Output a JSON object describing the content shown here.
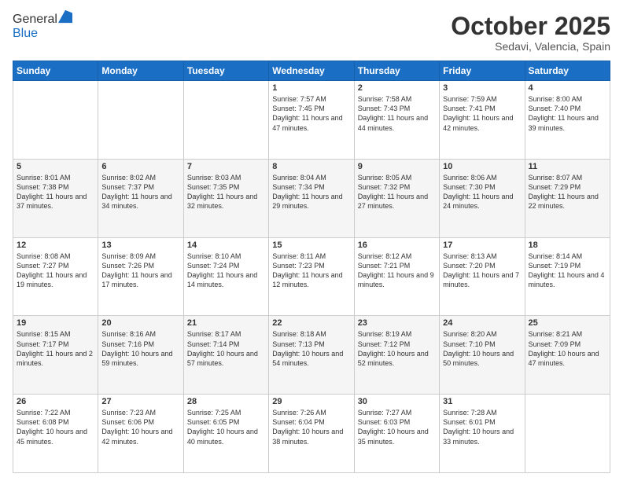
{
  "header": {
    "logo_line1": "General",
    "logo_line2": "Blue",
    "month": "October 2025",
    "location": "Sedavi, Valencia, Spain"
  },
  "weekdays": [
    "Sunday",
    "Monday",
    "Tuesday",
    "Wednesday",
    "Thursday",
    "Friday",
    "Saturday"
  ],
  "weeks": [
    [
      {
        "day": "",
        "info": ""
      },
      {
        "day": "",
        "info": ""
      },
      {
        "day": "",
        "info": ""
      },
      {
        "day": "1",
        "info": "Sunrise: 7:57 AM\nSunset: 7:45 PM\nDaylight: 11 hours and 47 minutes."
      },
      {
        "day": "2",
        "info": "Sunrise: 7:58 AM\nSunset: 7:43 PM\nDaylight: 11 hours and 44 minutes."
      },
      {
        "day": "3",
        "info": "Sunrise: 7:59 AM\nSunset: 7:41 PM\nDaylight: 11 hours and 42 minutes."
      },
      {
        "day": "4",
        "info": "Sunrise: 8:00 AM\nSunset: 7:40 PM\nDaylight: 11 hours and 39 minutes."
      }
    ],
    [
      {
        "day": "5",
        "info": "Sunrise: 8:01 AM\nSunset: 7:38 PM\nDaylight: 11 hours and 37 minutes."
      },
      {
        "day": "6",
        "info": "Sunrise: 8:02 AM\nSunset: 7:37 PM\nDaylight: 11 hours and 34 minutes."
      },
      {
        "day": "7",
        "info": "Sunrise: 8:03 AM\nSunset: 7:35 PM\nDaylight: 11 hours and 32 minutes."
      },
      {
        "day": "8",
        "info": "Sunrise: 8:04 AM\nSunset: 7:34 PM\nDaylight: 11 hours and 29 minutes."
      },
      {
        "day": "9",
        "info": "Sunrise: 8:05 AM\nSunset: 7:32 PM\nDaylight: 11 hours and 27 minutes."
      },
      {
        "day": "10",
        "info": "Sunrise: 8:06 AM\nSunset: 7:30 PM\nDaylight: 11 hours and 24 minutes."
      },
      {
        "day": "11",
        "info": "Sunrise: 8:07 AM\nSunset: 7:29 PM\nDaylight: 11 hours and 22 minutes."
      }
    ],
    [
      {
        "day": "12",
        "info": "Sunrise: 8:08 AM\nSunset: 7:27 PM\nDaylight: 11 hours and 19 minutes."
      },
      {
        "day": "13",
        "info": "Sunrise: 8:09 AM\nSunset: 7:26 PM\nDaylight: 11 hours and 17 minutes."
      },
      {
        "day": "14",
        "info": "Sunrise: 8:10 AM\nSunset: 7:24 PM\nDaylight: 11 hours and 14 minutes."
      },
      {
        "day": "15",
        "info": "Sunrise: 8:11 AM\nSunset: 7:23 PM\nDaylight: 11 hours and 12 minutes."
      },
      {
        "day": "16",
        "info": "Sunrise: 8:12 AM\nSunset: 7:21 PM\nDaylight: 11 hours and 9 minutes."
      },
      {
        "day": "17",
        "info": "Sunrise: 8:13 AM\nSunset: 7:20 PM\nDaylight: 11 hours and 7 minutes."
      },
      {
        "day": "18",
        "info": "Sunrise: 8:14 AM\nSunset: 7:19 PM\nDaylight: 11 hours and 4 minutes."
      }
    ],
    [
      {
        "day": "19",
        "info": "Sunrise: 8:15 AM\nSunset: 7:17 PM\nDaylight: 11 hours and 2 minutes."
      },
      {
        "day": "20",
        "info": "Sunrise: 8:16 AM\nSunset: 7:16 PM\nDaylight: 10 hours and 59 minutes."
      },
      {
        "day": "21",
        "info": "Sunrise: 8:17 AM\nSunset: 7:14 PM\nDaylight: 10 hours and 57 minutes."
      },
      {
        "day": "22",
        "info": "Sunrise: 8:18 AM\nSunset: 7:13 PM\nDaylight: 10 hours and 54 minutes."
      },
      {
        "day": "23",
        "info": "Sunrise: 8:19 AM\nSunset: 7:12 PM\nDaylight: 10 hours and 52 minutes."
      },
      {
        "day": "24",
        "info": "Sunrise: 8:20 AM\nSunset: 7:10 PM\nDaylight: 10 hours and 50 minutes."
      },
      {
        "day": "25",
        "info": "Sunrise: 8:21 AM\nSunset: 7:09 PM\nDaylight: 10 hours and 47 minutes."
      }
    ],
    [
      {
        "day": "26",
        "info": "Sunrise: 7:22 AM\nSunset: 6:08 PM\nDaylight: 10 hours and 45 minutes."
      },
      {
        "day": "27",
        "info": "Sunrise: 7:23 AM\nSunset: 6:06 PM\nDaylight: 10 hours and 42 minutes."
      },
      {
        "day": "28",
        "info": "Sunrise: 7:25 AM\nSunset: 6:05 PM\nDaylight: 10 hours and 40 minutes."
      },
      {
        "day": "29",
        "info": "Sunrise: 7:26 AM\nSunset: 6:04 PM\nDaylight: 10 hours and 38 minutes."
      },
      {
        "day": "30",
        "info": "Sunrise: 7:27 AM\nSunset: 6:03 PM\nDaylight: 10 hours and 35 minutes."
      },
      {
        "day": "31",
        "info": "Sunrise: 7:28 AM\nSunset: 6:01 PM\nDaylight: 10 hours and 33 minutes."
      },
      {
        "day": "",
        "info": ""
      }
    ]
  ]
}
